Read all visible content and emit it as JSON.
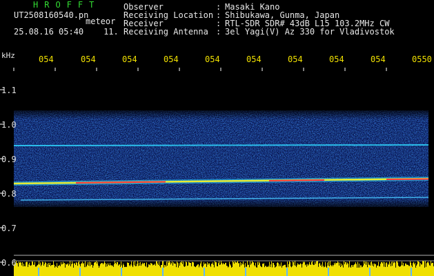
{
  "header": {
    "title": "HROFFT",
    "filename": "UT2508160540.pn",
    "suffix": "meteor",
    "timestamp": "25.08.16 05:40",
    "count": "11.",
    "info": [
      {
        "label": "Observer",
        "sep": ":",
        "value": "Masaki Kano"
      },
      {
        "label": "Receiving Location",
        "sep": ":",
        "value": "Shibukawa, Gunma, Japan"
      },
      {
        "label": "Receiver",
        "sep": ":",
        "value": "RTL-SDR SDR# 43dB L15 103.2MHz CW"
      },
      {
        "label": "Receiving Antenna",
        "sep": ":",
        "value": "3el Yagi(V) Az 330 for Vladivostok"
      }
    ]
  },
  "axis": {
    "unit": "kHz",
    "x_ticks": [
      "054",
      "054",
      "054",
      "054",
      "054",
      "054",
      "054",
      "054",
      "054",
      "0550"
    ],
    "y_ticks": [
      "1.1",
      "1.0",
      "0.9",
      "0.8",
      "0.7",
      "0.6"
    ]
  },
  "colors": {
    "background": "#000000",
    "tick_label": "#f0e000",
    "title": "#33dd33",
    "bars": "#f0e000",
    "marker": "#5fb8ff"
  }
}
